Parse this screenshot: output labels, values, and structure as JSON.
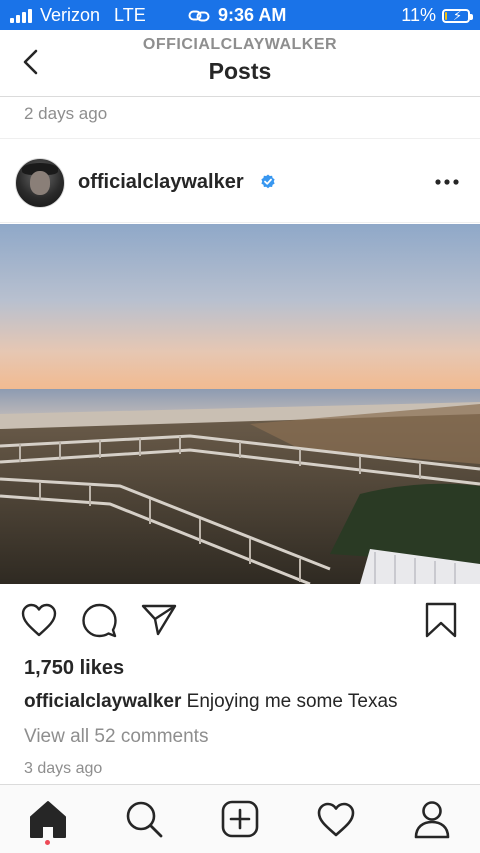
{
  "status_bar": {
    "carrier": "Verizon",
    "network": "LTE",
    "time": "9:36 AM",
    "battery": "11%",
    "battery_level": 0.11
  },
  "header": {
    "account": "OFFICIALCLAYWALKER",
    "title": "Posts"
  },
  "previous_post": {
    "timestamp": "2 days ago"
  },
  "post": {
    "username": "officialclaywalker",
    "verified": true,
    "likes": "1,750 likes",
    "caption_user": "officialclaywalker",
    "caption_text": "Enjoying me some Texas",
    "comments_link": "View all 52 comments",
    "timestamp": "3 days ago"
  },
  "icons": {
    "back": "chevron-left-icon",
    "more": "more-horizontal-icon",
    "like": "heart-icon",
    "comment": "comment-icon",
    "share": "send-icon",
    "save": "bookmark-icon",
    "nav": [
      "home-icon",
      "search-icon",
      "add-post-icon",
      "activity-heart-icon",
      "profile-icon"
    ]
  },
  "colors": {
    "status_bar": "#1a73e8",
    "verified": "#3897f0",
    "notification_dot": "#ed4956"
  }
}
